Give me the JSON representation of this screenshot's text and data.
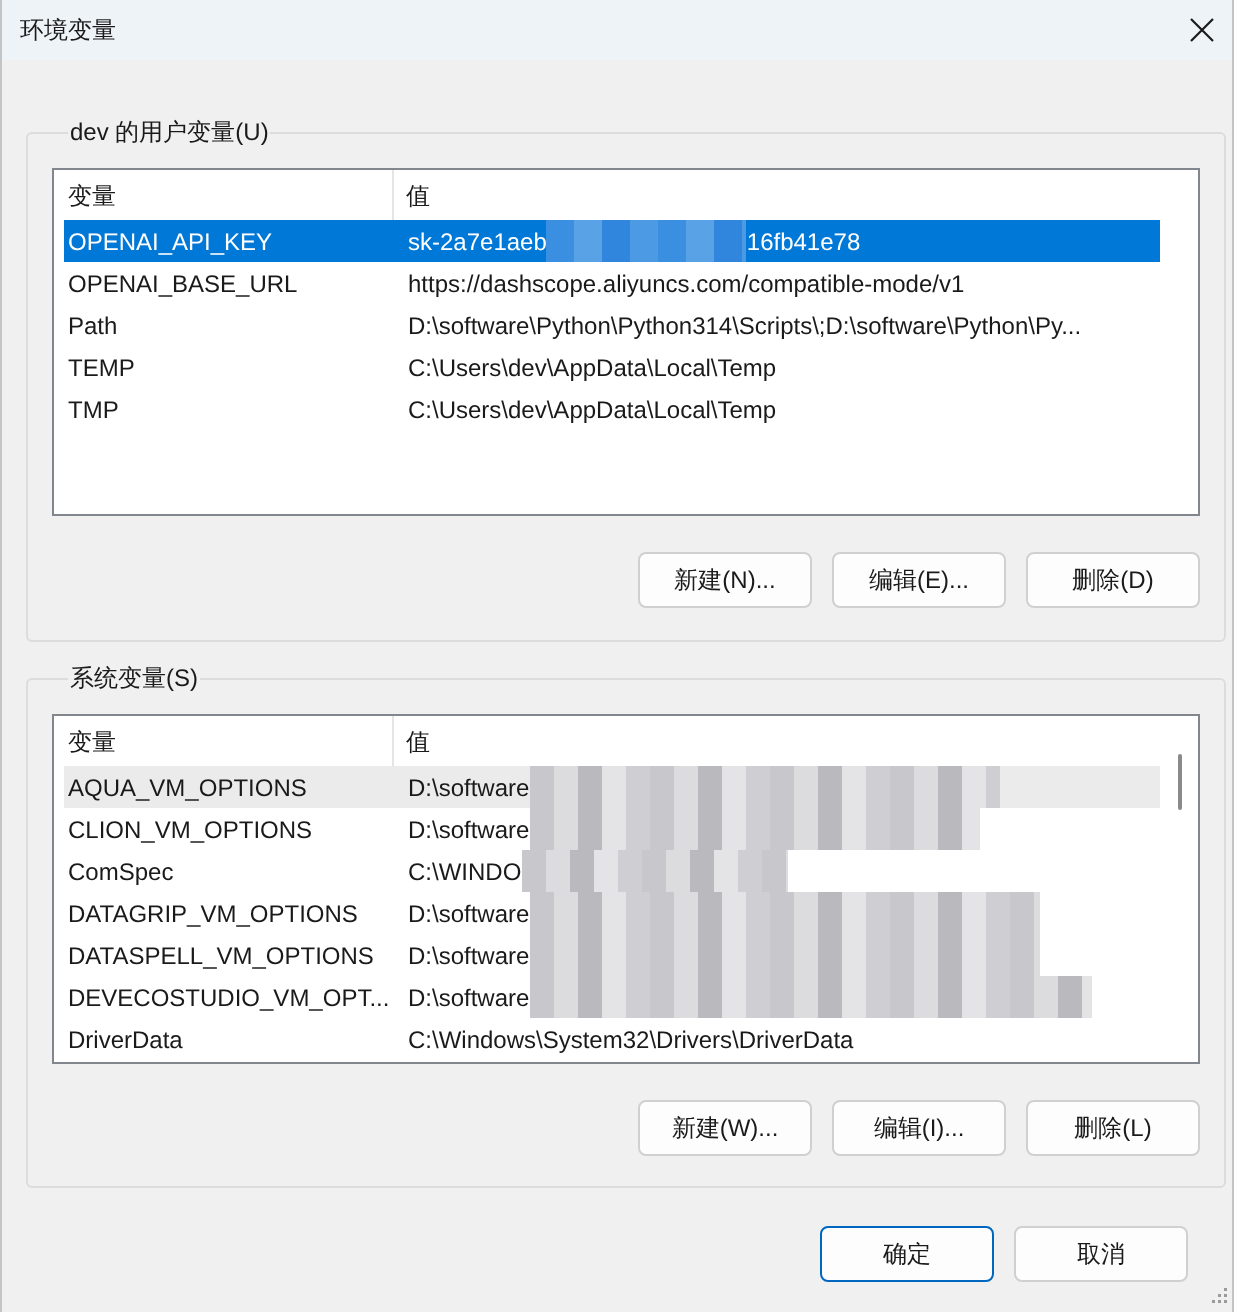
{
  "window": {
    "title": "环境变量"
  },
  "user_variables": {
    "label": "dev 的用户变量(U)",
    "focused": true,
    "scrollable": false,
    "columns": [
      "变量",
      "值"
    ],
    "rows": [
      {
        "name": "OPENAI_API_KEY",
        "value": "sk-2a7e1aeb",
        "redacted": true,
        "value_after": "16fb41e78",
        "selected": true
      },
      {
        "name": "OPENAI_BASE_URL",
        "value": "https://dashscope.aliyuncs.com/compatible-mode/v1",
        "redacted": false,
        "selected": false
      },
      {
        "name": "Path",
        "value": "D:\\software\\Python\\Python314\\Scripts\\;D:\\software\\Python\\Py...",
        "redacted": false,
        "selected": false
      },
      {
        "name": "TEMP",
        "value": "C:\\Users\\dev\\AppData\\Local\\Temp",
        "redacted": false,
        "selected": false
      },
      {
        "name": "TMP",
        "value": "C:\\Users\\dev\\AppData\\Local\\Temp",
        "redacted": false,
        "selected": false
      }
    ],
    "buttons": [
      "新建(N)...",
      "编辑(E)...",
      "删除(D)"
    ]
  },
  "system_variables": {
    "label": "系统变量(S)",
    "focused": false,
    "scrollable": true,
    "columns": [
      "变量",
      "值"
    ],
    "rows": [
      {
        "name": "AQUA_VM_OPTIONS",
        "value": "D:\\software",
        "redacted": true,
        "selected": true
      },
      {
        "name": "CLION_VM_OPTIONS",
        "value": "D:\\software",
        "redacted": true,
        "selected": false
      },
      {
        "name": "ComSpec",
        "value": "C:\\WINDO",
        "redacted": true,
        "selected": false
      },
      {
        "name": "DATAGRIP_VM_OPTIONS",
        "value": "D:\\software",
        "redacted": true,
        "selected": false
      },
      {
        "name": "DATASPELL_VM_OPTIONS",
        "value": "D:\\software",
        "redacted": true,
        "selected": false
      },
      {
        "name": "DEVECOSTUDIO_VM_OPT...",
        "value": "D:\\software",
        "redacted": true,
        "selected": false
      },
      {
        "name": "DriverData",
        "value": "C:\\Windows\\System32\\Drivers\\DriverData",
        "redacted": false,
        "selected": false
      }
    ],
    "buttons": [
      "新建(W)...",
      "编辑(I)...",
      "删除(L)"
    ]
  },
  "dialog_buttons": [
    {
      "label": "确定",
      "default": true
    },
    {
      "label": "取消",
      "default": false
    }
  ]
}
